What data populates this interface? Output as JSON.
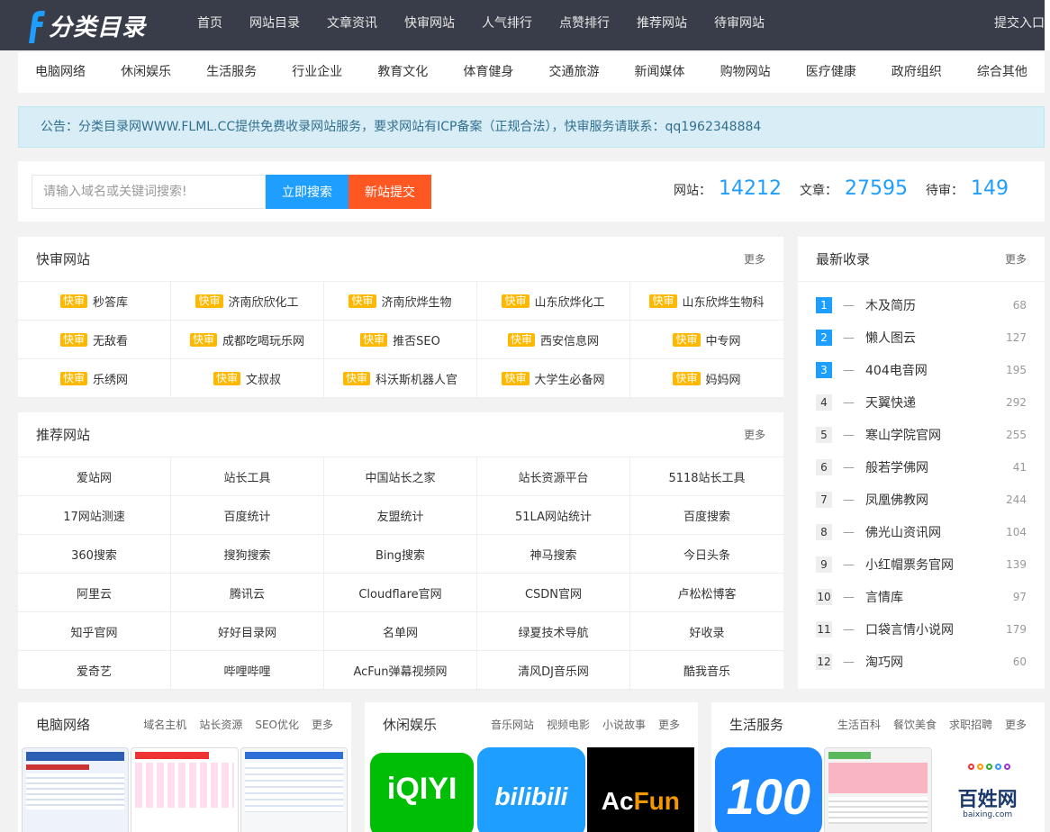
{
  "header": {
    "logo_text": "分类目录",
    "nav": [
      "首页",
      "网站目录",
      "文章资讯",
      "快审网站",
      "人气排行",
      "点赞排行",
      "推荐网站",
      "待审网站"
    ],
    "submit": "提交入口"
  },
  "categories": [
    "电脑网络",
    "休闲娱乐",
    "生活服务",
    "行业企业",
    "教育文化",
    "体育健身",
    "交通旅游",
    "新闻媒体",
    "购物网站",
    "医疗健康",
    "政府组织",
    "综合其他"
  ],
  "notice": "公告：分类目录网WWW.FLML.CC提供免费收录网站服务，要求网站有ICP备案（正规合法），快审服务请联系：qq1962348884",
  "search": {
    "placeholder": "请输入域名或关键词搜索!",
    "search_button": "立即搜索",
    "new_button": "新站提交"
  },
  "stats": {
    "sites_label": "网站：",
    "sites": "14212",
    "articles_label": "文章：",
    "articles": "27595",
    "pending_label": "待审：",
    "pending": "149"
  },
  "fast": {
    "title": "快审网站",
    "more": "更多",
    "badge": "快审",
    "items": [
      "秒答库",
      "济南欣欣化工",
      "济南欣烨生物",
      "山东欣烨化工",
      "山东欣烨生物科",
      "无敌看",
      "成都吃喝玩乐网",
      "推否SEO",
      "西安信息网",
      "中专网",
      "乐绣网",
      "文叔叔",
      "科沃斯机器人官",
      "大学生必备网",
      "妈妈网"
    ]
  },
  "recommend": {
    "title": "推荐网站",
    "more": "更多",
    "items": [
      "爱站网",
      "站长工具",
      "中国站长之家",
      "站长资源平台",
      "5118站长工具",
      "17网站测速",
      "百度统计",
      "友盟统计",
      "51LA网站统计",
      "百度搜索",
      "360搜索",
      "搜狗搜索",
      "Bing搜索",
      "神马搜索",
      "今日头条",
      "阿里云",
      "腾讯云",
      "Cloudflare官网",
      "CSDN官网",
      "卢松松博客",
      "知乎官网",
      "好好目录网",
      "名单网",
      "绿夏技术导航",
      "好收录",
      "爱奇艺",
      "哔哩哔哩",
      "AcFun弹幕视频网",
      "清风DJ音乐网",
      "酷我音乐"
    ]
  },
  "latest": {
    "title": "最新收录",
    "more": "更多",
    "items": [
      {
        "rank": "1",
        "name": "木及简历",
        "count": "68"
      },
      {
        "rank": "2",
        "name": "懒人图云",
        "count": "127"
      },
      {
        "rank": "3",
        "name": "404电音网",
        "count": "195"
      },
      {
        "rank": "4",
        "name": "天翼快递",
        "count": "292"
      },
      {
        "rank": "5",
        "name": "寒山学院官网",
        "count": "255"
      },
      {
        "rank": "6",
        "name": "般若学佛网",
        "count": "41"
      },
      {
        "rank": "7",
        "name": "凤凰佛教网",
        "count": "244"
      },
      {
        "rank": "8",
        "name": "佛光山资讯网",
        "count": "104"
      },
      {
        "rank": "9",
        "name": "小红帽票务官网",
        "count": "139"
      },
      {
        "rank": "10",
        "name": "言情库",
        "count": "97"
      },
      {
        "rank": "11",
        "name": "口袋言情小说网",
        "count": "179"
      },
      {
        "rank": "12",
        "name": "淘巧网",
        "count": "60"
      }
    ]
  },
  "bottom": [
    {
      "title": "电脑网络",
      "tags": [
        "域名主机",
        "站长资源",
        "SEO优化",
        "更多"
      ]
    },
    {
      "title": "休闲娱乐",
      "tags": [
        "音乐网站",
        "视频电影",
        "小说故事",
        "更多"
      ]
    },
    {
      "title": "生活服务",
      "tags": [
        "生活百科",
        "餐饮美食",
        "求职招聘",
        "更多"
      ]
    }
  ],
  "thumb_labels": {
    "iqiyi": "iQIYI",
    "bilibili": "bilibili",
    "acfun_a": "Ac",
    "acfun_b": "Fun",
    "hundred": "100",
    "baixing": "百姓网",
    "baixing_url": "baixing.com"
  },
  "colors": {
    "accent": "#1e9fff",
    "orange": "#ff5722",
    "badge": "#ffb800",
    "topbar": "#393d49"
  }
}
